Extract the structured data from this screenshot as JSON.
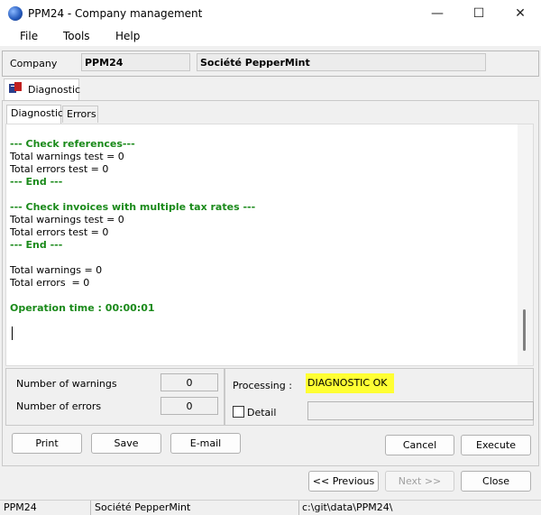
{
  "window": {
    "title": "PPM24 - Company management",
    "controls": {
      "minimize": "—",
      "maximize": "☐",
      "close": "✕"
    }
  },
  "menu": {
    "items": [
      "File",
      "Tools",
      "Help"
    ]
  },
  "company": {
    "label": "Company",
    "code": "PPM24",
    "name": "Société PepperMint"
  },
  "outer_tab": {
    "label": "Diagnostic"
  },
  "inner_tabs": [
    "Diagnostic",
    "Errors"
  ],
  "log": {
    "lines": [
      {
        "text": "--- Check references---",
        "style": "green"
      },
      {
        "text": "Total warnings test = 0",
        "style": "normal"
      },
      {
        "text": "Total errors test = 0",
        "style": "normal"
      },
      {
        "text": "--- End ---",
        "style": "green"
      },
      {
        "text": "",
        "style": "normal"
      },
      {
        "text": "--- Check invoices with multiple tax rates ---",
        "style": "green"
      },
      {
        "text": "Total warnings test = 0",
        "style": "normal"
      },
      {
        "text": "Total errors test = 0",
        "style": "normal"
      },
      {
        "text": "--- End ---",
        "style": "green"
      },
      {
        "text": "",
        "style": "normal"
      },
      {
        "text": "Total warnings = 0",
        "style": "normal"
      },
      {
        "text": "Total errors  = 0",
        "style": "normal"
      },
      {
        "text": "",
        "style": "normal"
      },
      {
        "text": "Operation time : 00:00:01",
        "style": "green"
      }
    ]
  },
  "counters": {
    "warnings_label": "Number of warnings",
    "warnings_value": "0",
    "errors_label": "Number of errors",
    "errors_value": "0"
  },
  "status": {
    "processing_label": "Processing :",
    "processing_value": "DIAGNOSTIC OK",
    "processing_color": "#ffff33",
    "detail_label": "Detail",
    "detail_checked": false
  },
  "actions": {
    "print": "Print",
    "save": "Save",
    "email": "E-mail",
    "cancel": "Cancel",
    "execute": "Execute"
  },
  "navigation": {
    "previous": "<< Previous",
    "next": "Next >>",
    "close": "Close"
  },
  "statusbar": {
    "code": "PPM24",
    "name": "Société PepperMint",
    "path": "c:\\git\\data\\PPM24\\"
  },
  "colors": {
    "log_green": "#1a8a1a",
    "highlight": "#ffff33"
  }
}
